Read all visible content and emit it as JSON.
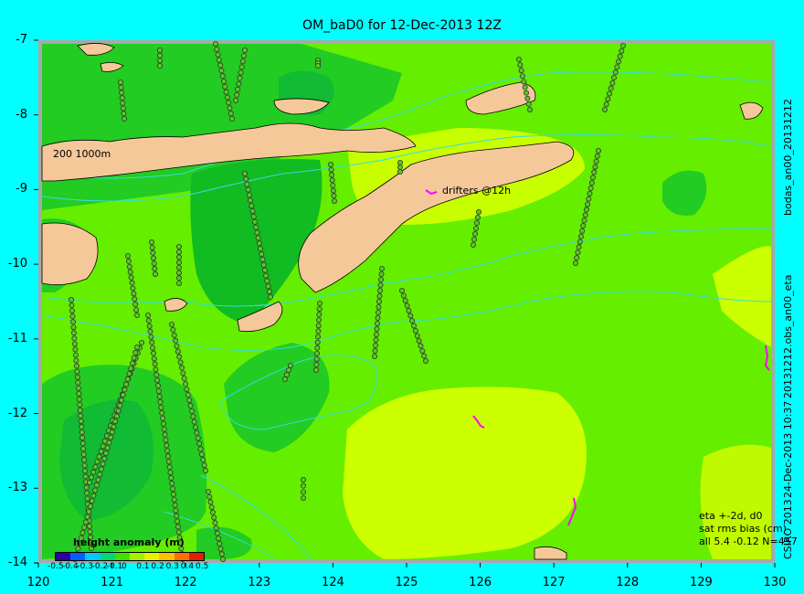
{
  "title": "OM_baD0 for 12-Dec-2013 12Z",
  "y_ticks": [
    "-7",
    "-8",
    "-9",
    "-10",
    "-11",
    "-12",
    "-13",
    "-14"
  ],
  "x_ticks": [
    "120",
    "121",
    "122",
    "123",
    "124",
    "125",
    "126",
    "127",
    "128",
    "129",
    "130"
  ],
  "right_labels": {
    "top": "bodas_an00_20131212",
    "middle": "20131212.obs_an00_eta",
    "bottom": "24-Dec-2013 10:37",
    "copyright": "CSIRO 2013"
  },
  "stats": {
    "line1": "eta +-2d, d0",
    "line2": "sat rms bias (cm)",
    "line3": "all 5.4 -0.12 N=457"
  },
  "map_labels": {
    "isobaths": "200  1000m",
    "drifters": "drifters @12h"
  },
  "colorbar": {
    "title": "height anomaly (m)",
    "ticks": [
      "-0.5",
      "-0.4",
      "-0.3",
      "-0.2",
      "-0.1",
      "0",
      "0.1",
      "0.2",
      "0.3",
      "0.4",
      "0.5"
    ],
    "colors": [
      "#2a00a0",
      "#0060ff",
      "#00c8ff",
      "#00d870",
      "#40e000",
      "#a0f000",
      "#e8f000",
      "#ffc000",
      "#ff7000",
      "#e02000"
    ]
  },
  "colors": {
    "background": "#00ffff",
    "land": "#f5c89a",
    "shelf": "#a0a0a0",
    "field_base": "#66ee00",
    "field_low": "#11cc11",
    "field_high": "#c8ff00",
    "drifter": "#ff00ff"
  }
}
